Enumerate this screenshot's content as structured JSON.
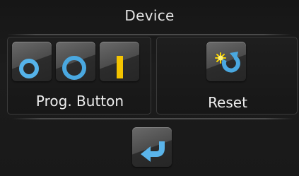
{
  "header": {
    "title": "Device"
  },
  "prog_button": {
    "label": "Prog. Button",
    "icons": [
      "ring-off-icon",
      "ring-on-icon",
      "bar-indicator-icon"
    ]
  },
  "reset": {
    "label": "Reset",
    "icon": "reset-sun-arrow-icon"
  },
  "back": {
    "icon": "back-arrow-icon"
  },
  "colors": {
    "background": "#1a1a1a",
    "text": "#e4e4e4",
    "accent_blue": "#4aa8e0",
    "accent_yellow": "#f4c400"
  }
}
